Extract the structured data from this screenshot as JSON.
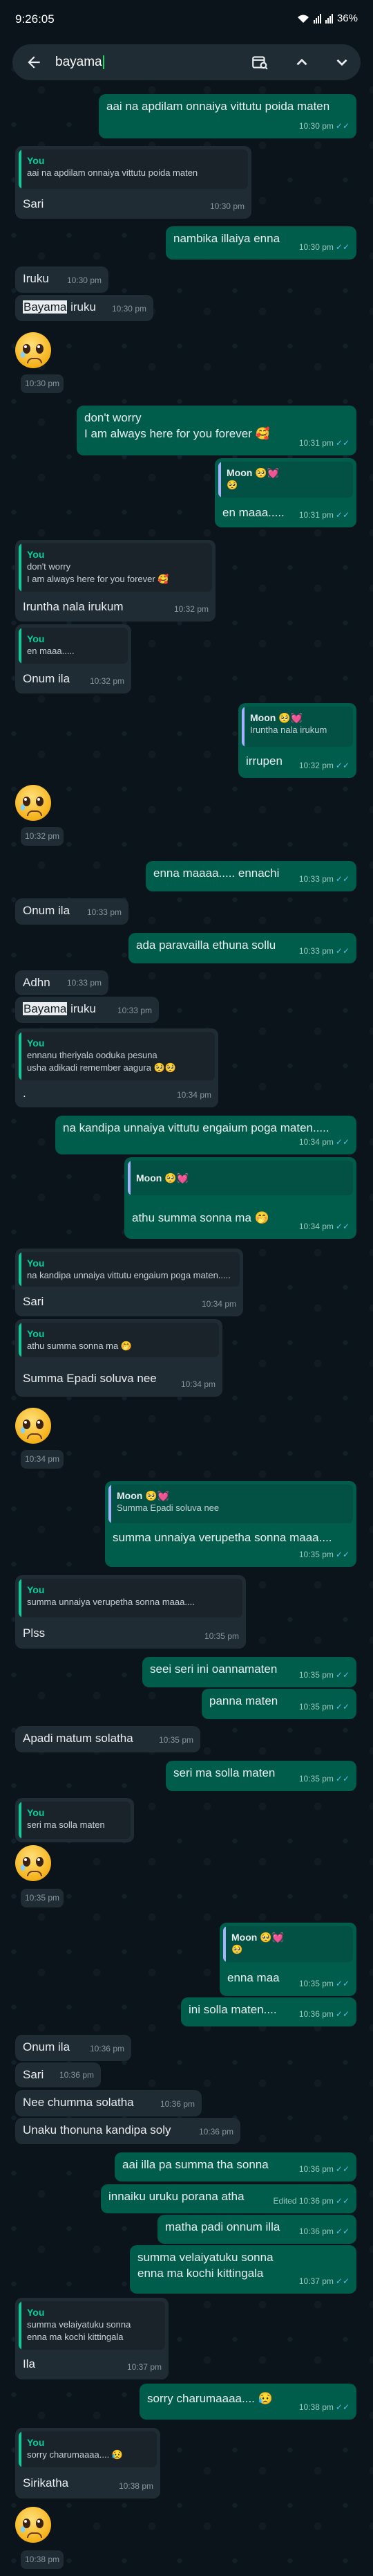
{
  "status_bar": {
    "time": "9:26:05",
    "battery": "36%"
  },
  "search": {
    "query": "bayama"
  },
  "messages": [
    {
      "text": "aai na apdilam onnaiya vittutu poida maten",
      "time": "10:30 pm"
    },
    {
      "quote_name": "You",
      "quote_text": "aai na apdilam onnaiya vittutu poida maten",
      "text": "Sari",
      "time": "10:30 pm"
    },
    {
      "text": "nambika illaiya enna",
      "time": "10:30 pm"
    },
    {
      "text": "Iruku",
      "time": "10:30 pm"
    },
    {
      "text_hl": "Bayama",
      "text_rest": " iruku",
      "time": "10:30 pm"
    },
    {
      "time": "10:30 pm"
    },
    {
      "line1": "don't worry",
      "line2": "I am always here for you forever 🥰",
      "time": "10:31 pm"
    },
    {
      "quote_name": "Moon 🥺💓",
      "quote_text": "🥺",
      "text": "en maaa.....",
      "time": "10:31 pm"
    },
    {
      "quote_name": "You",
      "quote_text1": "don't worry",
      "quote_text2": "I am always here for you forever 🥰",
      "text": "Iruntha nala irukum",
      "time": "10:32 pm"
    },
    {
      "quote_name": "You",
      "quote_text": "en maaa.....",
      "text": "Onum ila",
      "time": "10:32 pm"
    },
    {
      "quote_name": "Moon 🥺💓",
      "quote_text": "Iruntha nala irukum",
      "text": "irrupen",
      "time": "10:32 pm"
    },
    {
      "time": "10:32 pm"
    },
    {
      "text": "enna maaaa..... ennachi",
      "time": "10:33 pm"
    },
    {
      "text": "Onum ila",
      "time": "10:33 pm"
    },
    {
      "text": "ada paravailla ethuna sollu",
      "time": "10:33 pm"
    },
    {
      "text": "Adhn",
      "time": "10:33 pm"
    },
    {
      "text_hl": "Bayama",
      "text_rest": " iruku",
      "time": "10:33 pm"
    },
    {
      "quote_name": "You",
      "quote_text1": "ennanu theriyala ooduka pesuna",
      "quote_text2": "usha adikadi remember aagura 🥺🥺",
      "text": ".",
      "time": "10:34 pm"
    },
    {
      "text": "na kandipa unnaiya vittutu engaium poga maten.....",
      "time": "10:34 pm"
    },
    {
      "quote_name": "Moon 🥺💓",
      "quote_text": "",
      "text": "athu summa sonna ma 🤭",
      "time": "10:34 pm"
    },
    {
      "quote_name": "You",
      "quote_text": "na kandipa unnaiya vittutu engaium poga maten.....",
      "text": "Sari",
      "time": "10:34 pm"
    },
    {
      "quote_name": "You",
      "quote_text": "athu summa sonna ma 🤭",
      "text": "Summa Epadi soluva nee",
      "time": "10:34 pm"
    },
    {
      "time": "10:34 pm"
    },
    {
      "quote_name": "Moon 🥺💓",
      "quote_text": "Summa Epadi soluva nee",
      "text": "summa unnaiya verupetha sonna maaa....",
      "time": "10:35 pm"
    },
    {
      "quote_name": "You",
      "quote_text": "summa unnaiya verupetha sonna maaa....",
      "text": "Plss",
      "time": "10:35 pm"
    },
    {
      "text": "seei seri ini oannamaten",
      "time": "10:35 pm"
    },
    {
      "text": "panna maten",
      "time": "10:35 pm"
    },
    {
      "text": "Apadi matum solatha",
      "time": "10:35 pm"
    },
    {
      "text": "seri ma solla maten",
      "time": "10:35 pm"
    },
    {
      "quote_name": "You",
      "quote_text": "seri ma solla maten",
      "time": ""
    },
    {
      "time": "10:35 pm"
    },
    {
      "quote_name": "Moon 🥺💓",
      "quote_text": "🥺",
      "text": "enna maa",
      "time": "10:35 pm"
    },
    {
      "text": "ini solla maten....",
      "time": "10:36 pm"
    },
    {
      "text": "Onum ila",
      "time": "10:36 pm"
    },
    {
      "text": "Sari",
      "time": "10:36 pm"
    },
    {
      "text": "Nee chumma solatha",
      "time": "10:36 pm"
    },
    {
      "text": "Unaku thonuna kandipa soly",
      "time": "10:36 pm"
    },
    {
      "text": "aai illa pa summa tha sonna",
      "time": "10:36 pm"
    },
    {
      "text": "innaiku uruku porana atha",
      "edited": "Edited",
      "time": "10:36 pm"
    },
    {
      "text": "matha padi onnum illa",
      "time": "10:36 pm"
    },
    {
      "line1": "summa velaiyatuku sonna",
      "line2": "enna ma kochi kittingala",
      "time": "10:37 pm"
    },
    {
      "quote_name": "You",
      "quote_text1": "summa velaiyatuku sonna",
      "quote_text2": "enna ma kochi kittingala",
      "text": "Ila",
      "time": "10:37 pm"
    },
    {
      "text": "sorry charumaaaa.... 😥",
      "time": "10:38 pm"
    },
    {
      "quote_name": "You",
      "quote_text": "sorry charumaaaa.... 😥",
      "text": "Sirikatha",
      "time": "10:38 pm"
    },
    {
      "time": "10:38 pm"
    }
  ],
  "colors": {
    "outgoing": "#005c4b",
    "incoming": "#202c33",
    "background": "#0b141a",
    "read_ticks": "#53bdeb"
  },
  "icons": [
    "back-arrow-icon",
    "calendar-search-icon",
    "chevron-up-icon",
    "chevron-down-icon",
    "wifi-icon",
    "signal-icon",
    "battery-icon",
    "double-tick-icon",
    "pleading-face-emoji"
  ]
}
